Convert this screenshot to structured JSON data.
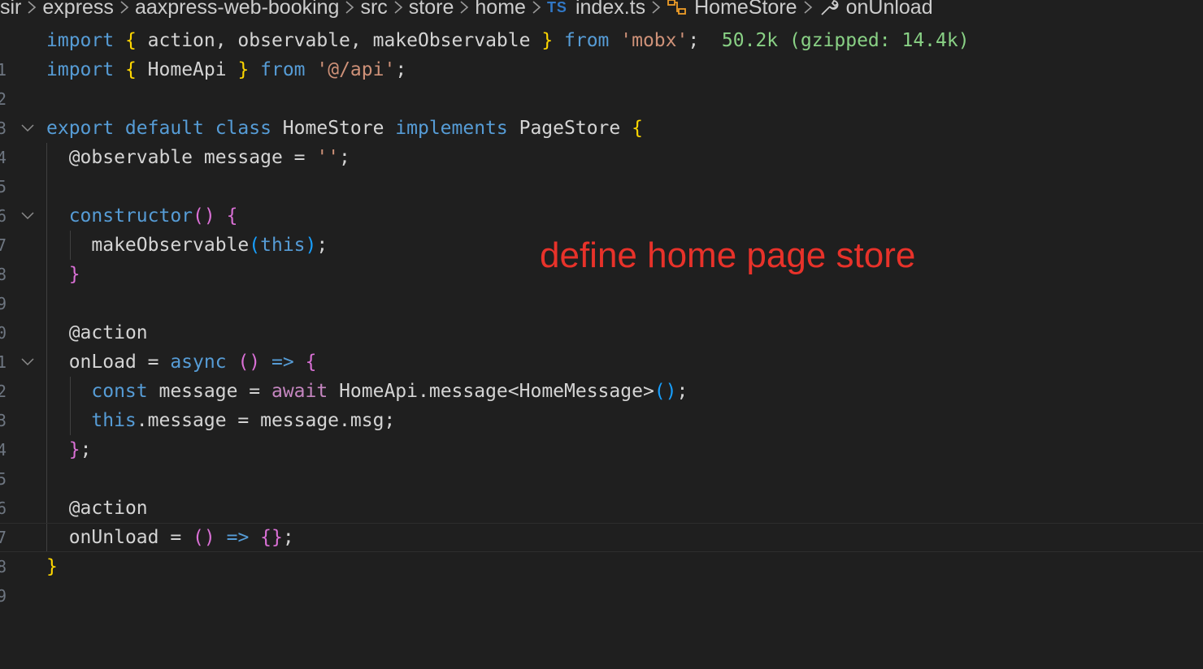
{
  "breadcrumb": {
    "items": [
      "sir",
      "express",
      "aaxpress-web-booking",
      "src",
      "store",
      "home"
    ],
    "file_badge": "TS",
    "file": "index.ts",
    "class_name": "HomeStore",
    "method_name": "onUnload"
  },
  "line_numbers": [
    "1",
    "2",
    "3",
    "4",
    "5",
    "6",
    "7",
    "8",
    "9",
    "0",
    "1",
    "2",
    "3",
    "4",
    "5",
    "6",
    "7",
    "8",
    "9"
  ],
  "code": {
    "l1": {
      "a": "import",
      "b": "{",
      "c": " action, observable, makeObservable ",
      "d": "}",
      "e": " from ",
      "f": "'mobx'",
      "g": ";",
      "hint": "50.2k (gzipped: 14.4k)"
    },
    "l2": {
      "a": "import",
      "b": "{",
      "c": " HomeApi ",
      "d": "}",
      "e": " from ",
      "f": "'@/api'",
      "g": ";"
    },
    "l4": {
      "a": "export default class",
      "b": " HomeStore ",
      "c": "implements",
      "d": " PageStore ",
      "e": "{"
    },
    "l5": {
      "a": "@observable message = ",
      "b": "''",
      "c": ";"
    },
    "l7": {
      "a": "constructor",
      "b": "()",
      "c": " ",
      "d": "{"
    },
    "l8": {
      "a": "makeObservable",
      "b": "(",
      "c": "this",
      "d": ")",
      "e": ";"
    },
    "l9": {
      "a": "}"
    },
    "l11": {
      "a": "@action"
    },
    "l12": {
      "a": "onLoad = ",
      "b": "async",
      "c": " ",
      "d": "()",
      "e": " ",
      "f": "=>",
      "g": " ",
      "h": "{"
    },
    "l13": {
      "a": "const",
      "b": " message = ",
      "c": "await",
      "d": " HomeApi.message<HomeMessage>",
      "e": "()",
      "f": ";"
    },
    "l14": {
      "a": "this",
      "b": ".message = message.msg;"
    },
    "l15": {
      "a": "}",
      "b": ";"
    },
    "l17": {
      "a": "@action"
    },
    "l18": {
      "a": "onUnload = ",
      "b": "()",
      "c": " ",
      "d": "=>",
      "e": " ",
      "f": "{}",
      "g": ";"
    },
    "l19": {
      "a": "}"
    }
  },
  "annotation": "define home page store",
  "colors": {
    "annotation": "#e8322a",
    "keyword": "#569cd6",
    "control": "#c586c0",
    "string": "#ce9178",
    "bracket1": "#ffd700",
    "bracket2": "#da70d6",
    "bracket3": "#179fff"
  }
}
